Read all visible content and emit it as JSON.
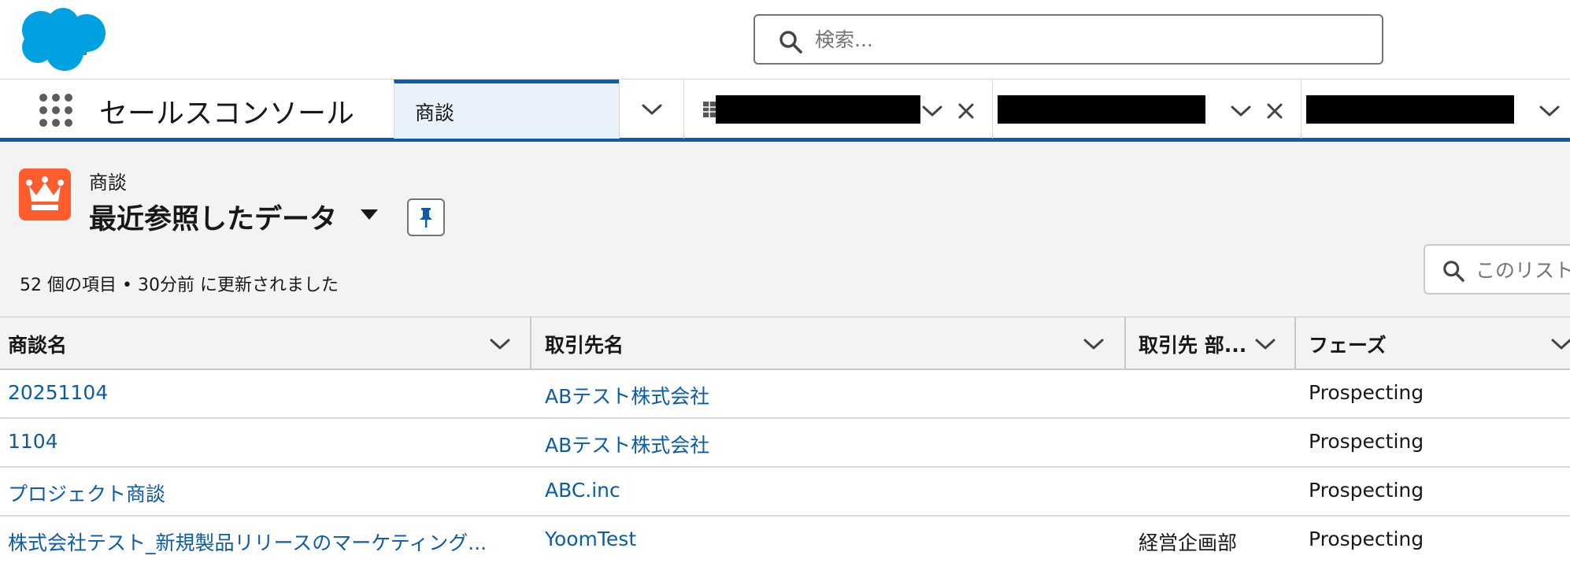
{
  "global_header": {
    "search_placeholder": "検索..."
  },
  "nav": {
    "app_name": "セールスコンソール",
    "active_tab_label": "商談"
  },
  "list_header": {
    "object_label": "商談",
    "list_view_title": "最近参照したデータ",
    "meta": "52 個の項目 • 30分前 に更新されました",
    "search_placeholder": "このリストを検索..."
  },
  "table": {
    "columns": [
      "商談名",
      "取引先名",
      "取引先 部...",
      "フェーズ"
    ],
    "rows": [
      {
        "opportunity": "20251104",
        "account": "ABテスト株式会社",
        "department": "",
        "stage": "Prospecting"
      },
      {
        "opportunity": "1104",
        "account": "ABテスト株式会社",
        "department": "",
        "stage": "Prospecting"
      },
      {
        "opportunity": "プロジェクト商談",
        "account": "ABC.inc",
        "department": "",
        "stage": "Prospecting"
      },
      {
        "opportunity": "株式会社テスト_新規製品リリースのマーケティング...",
        "account": "YoomTest",
        "department": "経営企画部",
        "stage": "Prospecting"
      }
    ]
  },
  "colors": {
    "brand_blue": "#0b5cab",
    "logo_blue": "#00a1e0",
    "opportunity_icon": "#ff5d2d"
  }
}
